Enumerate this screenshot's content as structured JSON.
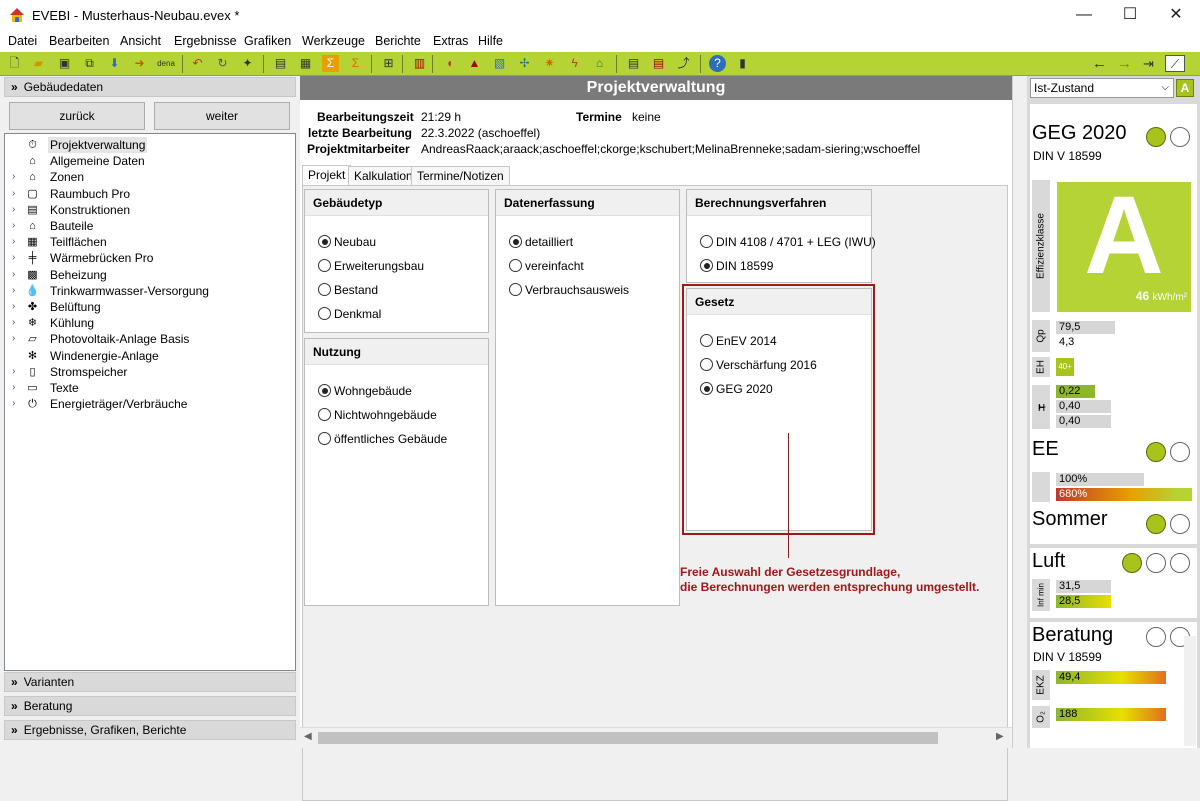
{
  "window": {
    "app": "EVEBI",
    "title": "EVEBI - Musterhaus-Neubau.evex *",
    "min": "—",
    "max": "☐",
    "close": "✕"
  },
  "menu": [
    "Datei",
    "Bearbeiten",
    "Ansicht",
    "Ergebnisse",
    "Grafiken",
    "Werkzeuge",
    "Berichte",
    "Extras",
    "Hilfe"
  ],
  "toolbar": {
    "dena": "dena"
  },
  "left": {
    "header": "Gebäudedaten",
    "back": "zurück",
    "next": "weiter",
    "tree": [
      {
        "label": "Projektverwaltung",
        "icon": "⏱",
        "expand": false,
        "selected": true
      },
      {
        "label": "Allgemeine Daten",
        "icon": "⌂",
        "expand": false
      },
      {
        "label": "Zonen",
        "icon": "⌂",
        "expand": true
      },
      {
        "label": "Raumbuch Pro",
        "icon": "▢",
        "expand": true
      },
      {
        "label": "Konstruktionen",
        "icon": "▤",
        "expand": true
      },
      {
        "label": "Bauteile",
        "icon": "⌂",
        "expand": true
      },
      {
        "label": "Teilflächen",
        "icon": "▦",
        "expand": true
      },
      {
        "label": "Wärmebrücken Pro",
        "icon": "╪",
        "expand": true
      },
      {
        "label": "Beheizung",
        "icon": "▩",
        "expand": true
      },
      {
        "label": "Trinkwarmwasser-Versorgung",
        "icon": "💧",
        "expand": true
      },
      {
        "label": "Belüftung",
        "icon": "✤",
        "expand": true
      },
      {
        "label": "Kühlung",
        "icon": "❄",
        "expand": true
      },
      {
        "label": "Photovoltaik-Anlage Basis",
        "icon": "▱",
        "expand": true
      },
      {
        "label": "Windenergie-Anlage",
        "icon": "✻",
        "expand": false
      },
      {
        "label": "Stromspeicher",
        "icon": "▯",
        "expand": true
      },
      {
        "label": "Texte",
        "icon": "▭",
        "expand": true
      },
      {
        "label": "Energieträger/Verbräuche",
        "icon": "⏻",
        "expand": true
      }
    ],
    "sections": [
      "Varianten",
      "Beratung",
      "Ergebnisse, Grafiken, Berichte"
    ]
  },
  "main": {
    "title": "Projektverwaltung",
    "info": {
      "bearbeitungszeit_label": "Bearbeitungszeit",
      "bearbeitungszeit": "21:29 h",
      "termine_label": "Termine",
      "termine": "keine",
      "letzte_label": "letzte Bearbeitung",
      "letzte": "22.3.2022 (aschoeffel)",
      "mitarbeiter_label": "Projektmitarbeiter",
      "mitarbeiter": "AndreasRaack;araack;aschoeffel;ckorge;kschubert;MelinaBrenneke;sadam-siering;wschoeffel"
    },
    "tabs": [
      "Projekt",
      "Kalkulation",
      "Termine/Notizen"
    ],
    "gebaeudetyp": {
      "title": "Gebäudetyp",
      "options": [
        "Neubau",
        "Erweiterungsbau",
        "Bestand",
        "Denkmal"
      ],
      "selected": 0
    },
    "nutzung": {
      "title": "Nutzung",
      "options": [
        "Wohngebäude",
        "Nichtwohngebäude",
        "öffentliches Gebäude"
      ],
      "selected": 0
    },
    "datenerfassung": {
      "title": "Datenerfassung",
      "options": [
        "detailliert",
        "vereinfacht",
        "Verbrauchsausweis"
      ],
      "selected": 0
    },
    "verfahren": {
      "title": "Berechnungsverfahren",
      "options": [
        "DIN 4108 / 4701 + LEG (IWU)",
        "DIN 18599"
      ],
      "selected": 1
    },
    "gesetz": {
      "title": "Gesetz",
      "options": [
        "EnEV 2014",
        "Verschärfung 2016",
        "GEG 2020"
      ],
      "selected": 2
    },
    "annotation": {
      "line1": "Freie Auswahl der Gesetzesgrundlage,",
      "line2": "die Berechnungen werden entsprechung umgestellt."
    }
  },
  "right": {
    "state": "Ist-Zustand",
    "state_badge": "A",
    "geg": {
      "title": "GEG 2020",
      "sub": "DIN V 18599"
    },
    "efficiency": {
      "label": "Effizienzklasse",
      "class": "A",
      "value": "46",
      "unit": "kWh/m²"
    },
    "qp": {
      "label": "Qp",
      "v1": "79,5",
      "v2": "4,3"
    },
    "eh": {
      "label": "EH",
      "badge": "40+"
    },
    "ht": {
      "label": "H",
      "sub": "T",
      "v1": "0,22",
      "v2": "0,40",
      "v3": "0,40"
    },
    "ee": {
      "title": "EE",
      "v1": "100%",
      "v2": "680%"
    },
    "sommer": {
      "title": "Sommer"
    },
    "luft": {
      "title": "Luft",
      "label": "Inf min",
      "v1": "31,5",
      "v2": "28,5"
    },
    "beratung": {
      "title": "Beratung",
      "sub": "DIN V 18599",
      "ekz_label": "EKZ",
      "ekz": "49,4",
      "co2_label": "O₂",
      "co2": "188"
    },
    "colors": {
      "accent": "#b5d334",
      "status_green": "#a8c31c",
      "red": "#c0392b"
    }
  }
}
